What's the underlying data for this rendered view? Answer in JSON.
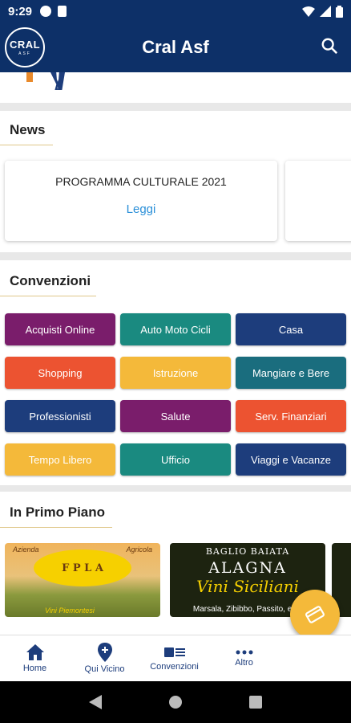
{
  "status": {
    "time": "9:29"
  },
  "header": {
    "title": "Cral Asf",
    "logo_main": "CRAL",
    "logo_sub": "ASF"
  },
  "news": {
    "title": "News",
    "cards": [
      {
        "title": "PROGRAMMA CULTURALE 2021",
        "link": "Leggi"
      }
    ]
  },
  "conventions": {
    "title": "Convenzioni",
    "categories": [
      {
        "label": "Acquisti Online",
        "color": "#7a1d6b"
      },
      {
        "label": "Auto Moto Cicli",
        "color": "#1a8a80"
      },
      {
        "label": "Casa",
        "color": "#1d3d7c"
      },
      {
        "label": "Shopping",
        "color": "#ec5331"
      },
      {
        "label": "Istruzione",
        "color": "#f4b93a"
      },
      {
        "label": "Mangiare e Bere",
        "color": "#1a6d7e"
      },
      {
        "label": "Professionisti",
        "color": "#1d3d7c"
      },
      {
        "label": "Salute",
        "color": "#7a1d6b"
      },
      {
        "label": "Serv. Finanziari",
        "color": "#ec5331"
      },
      {
        "label": "Tempo Libero",
        "color": "#f4b93a"
      },
      {
        "label": "Ufficio",
        "color": "#1a8a80"
      },
      {
        "label": "Viaggi e Vacanze",
        "color": "#1d3d7c"
      }
    ]
  },
  "featured": {
    "title": "In Primo Piano",
    "cards": [
      {
        "top_left": "Azienda",
        "top_right": "Agricola",
        "brand": "F  P  L A",
        "bottom": "Vini Piemontesi"
      },
      {
        "line1": "BAGLIO BAIATA",
        "line2": "ALAGNA",
        "line3": "Vini Siciliani",
        "line4": "Marsala, Zibibbo, Passito, ecc."
      }
    ]
  },
  "bottom_nav": [
    {
      "label": "Home",
      "icon": "home-icon"
    },
    {
      "label": "Qui Vicino",
      "icon": "location-icon"
    },
    {
      "label": "Convenzioni",
      "icon": "card-list-icon"
    },
    {
      "label": "Altro",
      "icon": "more-icon"
    }
  ],
  "colors": {
    "primary": "#0d3068",
    "accent": "#f4b93a",
    "link": "#2a8fd8"
  }
}
